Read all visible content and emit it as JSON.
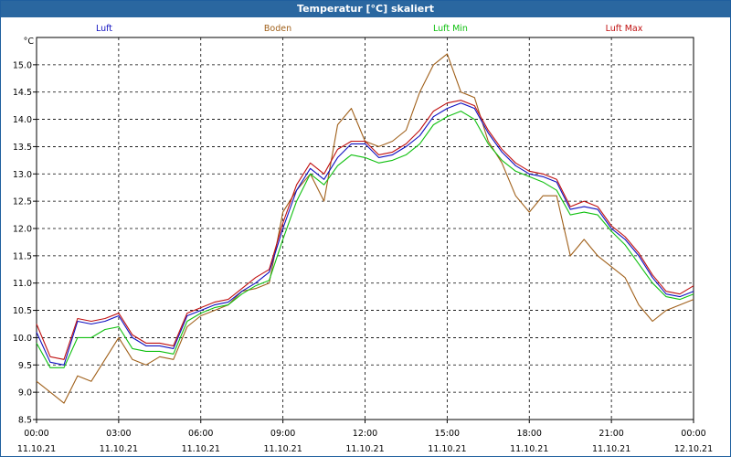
{
  "window": {
    "title": "Temperatur [°C] skaliert"
  },
  "chart_data": {
    "type": "line",
    "title": "Temperatur [°C] skaliert",
    "ylabel": "°C",
    "ylim": [
      8.5,
      15.5
    ],
    "yticks": [
      8.5,
      9.0,
      9.5,
      10.0,
      10.5,
      11.0,
      11.5,
      12.0,
      12.5,
      13.0,
      13.5,
      14.0,
      14.5,
      15.0
    ],
    "xlim": [
      0,
      24
    ],
    "xticks": [
      {
        "x": 0,
        "time": "00:00",
        "date": "11.10.21"
      },
      {
        "x": 3,
        "time": "03:00",
        "date": "11.10.21"
      },
      {
        "x": 6,
        "time": "06:00",
        "date": "11.10.21"
      },
      {
        "x": 9,
        "time": "09:00",
        "date": "11.10.21"
      },
      {
        "x": 12,
        "time": "12:00",
        "date": "11.10.21"
      },
      {
        "x": 15,
        "time": "15:00",
        "date": "11.10.21"
      },
      {
        "x": 18,
        "time": "18:00",
        "date": "11.10.21"
      },
      {
        "x": 21,
        "time": "21:00",
        "date": "11.10.21"
      },
      {
        "x": 24,
        "time": "00:00",
        "date": "12.10.21"
      }
    ],
    "grid": true,
    "legend_position": "top",
    "x": [
      0,
      0.5,
      1,
      1.5,
      2,
      2.5,
      3,
      3.5,
      4,
      4.5,
      5,
      5.5,
      6,
      6.5,
      7,
      7.5,
      8,
      8.5,
      9,
      9.5,
      10,
      10.5,
      11,
      11.5,
      12,
      12.5,
      13,
      13.5,
      14,
      14.5,
      15,
      15.5,
      16,
      16.5,
      17,
      17.5,
      18,
      18.5,
      19,
      19.5,
      20,
      20.5,
      21,
      21.5,
      22,
      22.5,
      23,
      23.5,
      24
    ],
    "series": [
      {
        "name": "Luft",
        "color": "#1010c0",
        "values": [
          10.1,
          9.55,
          9.5,
          10.3,
          10.25,
          10.3,
          10.4,
          10.0,
          9.85,
          9.85,
          9.8,
          10.4,
          10.5,
          10.6,
          10.65,
          10.85,
          11.0,
          11.2,
          12.0,
          12.7,
          13.1,
          12.9,
          13.3,
          13.55,
          13.55,
          13.3,
          13.35,
          13.5,
          13.7,
          14.05,
          14.2,
          14.3,
          14.2,
          13.75,
          13.4,
          13.15,
          13.0,
          12.95,
          12.85,
          12.35,
          12.4,
          12.35,
          12.0,
          11.8,
          11.5,
          11.1,
          10.8,
          10.75,
          10.85
        ]
      },
      {
        "name": "Boden",
        "color": "#a0601a",
        "values": [
          9.2,
          9.0,
          8.8,
          9.3,
          9.2,
          9.6,
          10.0,
          9.6,
          9.5,
          9.65,
          9.6,
          10.2,
          10.4,
          10.5,
          10.6,
          10.85,
          10.9,
          11.0,
          12.3,
          12.7,
          13.0,
          12.5,
          13.9,
          14.2,
          13.6,
          13.5,
          13.6,
          13.8,
          14.5,
          15.0,
          15.2,
          14.5,
          14.4,
          13.6,
          13.2,
          12.6,
          12.3,
          12.6,
          12.6,
          11.5,
          11.8,
          11.5,
          11.3,
          11.1,
          10.6,
          10.3,
          10.5,
          10.6,
          10.7
        ]
      },
      {
        "name": "Luft Min",
        "color": "#10c010",
        "values": [
          9.9,
          9.45,
          9.45,
          10.0,
          10.0,
          10.15,
          10.2,
          9.8,
          9.75,
          9.75,
          9.7,
          10.3,
          10.45,
          10.55,
          10.6,
          10.8,
          10.95,
          11.05,
          11.8,
          12.5,
          13.0,
          12.8,
          13.15,
          13.35,
          13.3,
          13.2,
          13.25,
          13.35,
          13.55,
          13.9,
          14.05,
          14.15,
          14.0,
          13.55,
          13.25,
          13.05,
          12.95,
          12.85,
          12.7,
          12.25,
          12.3,
          12.25,
          11.95,
          11.7,
          11.35,
          11.0,
          10.75,
          10.7,
          10.8
        ]
      },
      {
        "name": "Luft Max",
        "color": "#c01010",
        "values": [
          10.25,
          9.65,
          9.6,
          10.35,
          10.3,
          10.35,
          10.45,
          10.05,
          9.9,
          9.9,
          9.85,
          10.45,
          10.55,
          10.65,
          10.7,
          10.9,
          11.1,
          11.25,
          12.1,
          12.8,
          13.2,
          13.0,
          13.45,
          13.6,
          13.6,
          13.35,
          13.4,
          13.55,
          13.8,
          14.15,
          14.3,
          14.35,
          14.25,
          13.8,
          13.45,
          13.2,
          13.05,
          13.0,
          12.9,
          12.4,
          12.5,
          12.4,
          12.05,
          11.85,
          11.55,
          11.15,
          10.85,
          10.8,
          10.95
        ]
      }
    ]
  }
}
